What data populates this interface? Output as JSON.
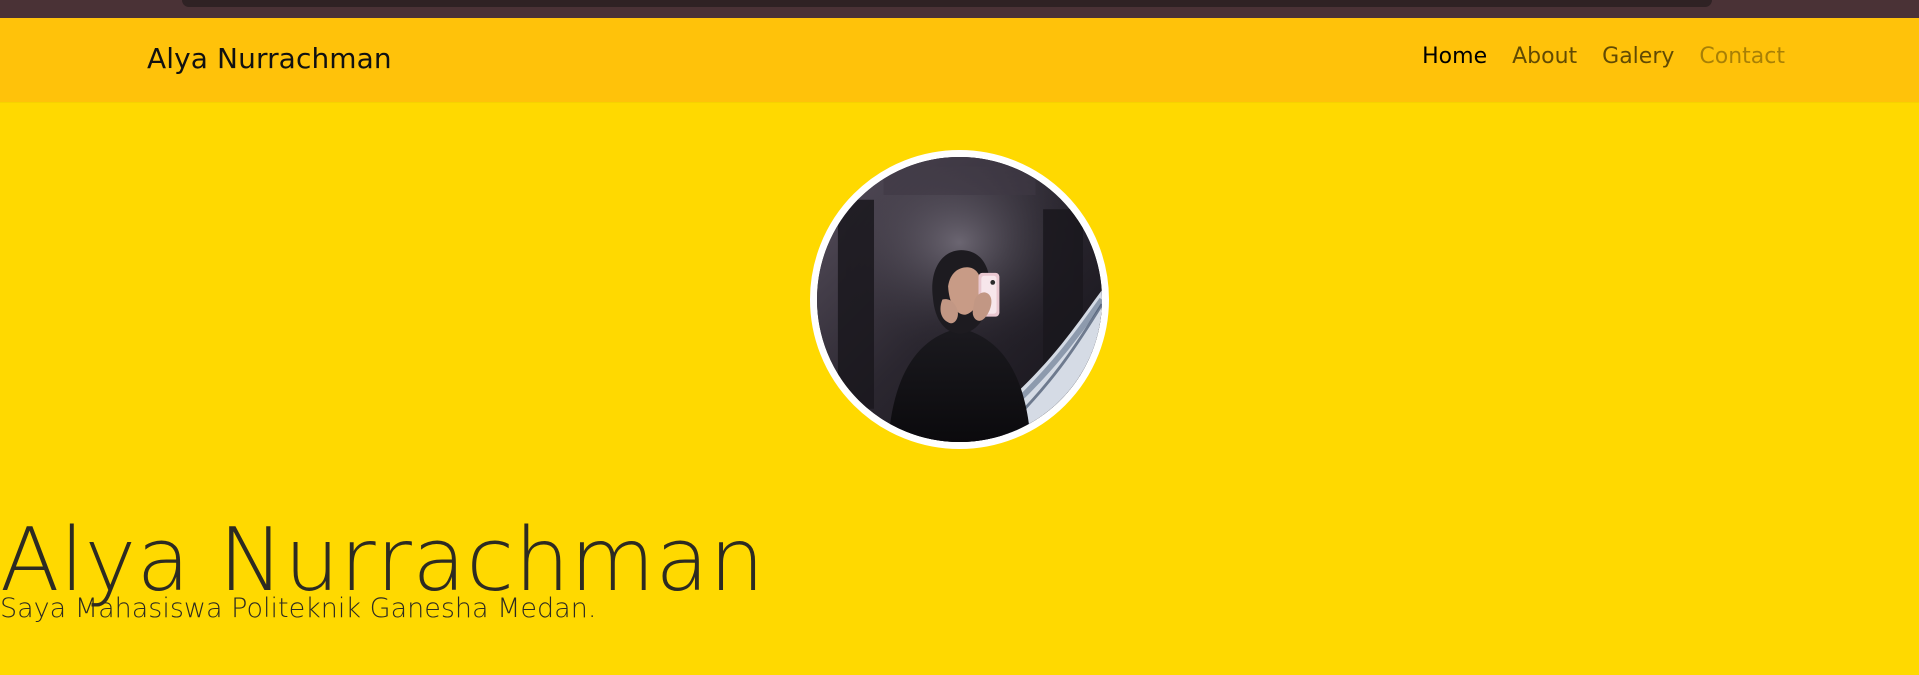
{
  "brand": {
    "name": "Alya Nurrachman"
  },
  "nav": [
    {
      "label": "Home",
      "state": "active"
    },
    {
      "label": "About",
      "state": "normal"
    },
    {
      "label": "Galery",
      "state": "normal"
    },
    {
      "label": "Contact",
      "state": "muted"
    }
  ],
  "hero": {
    "title": "Alya Nurrachman",
    "subtitle": "Saya Mahasiswa Politeknik Ganesha Medan."
  },
  "colors": {
    "page_background": "#ffd900",
    "navbar_background": "#ffc20a",
    "top_strip": "#4a3236",
    "avatar_border": "#ffffff"
  },
  "icons": {
    "avatar": "profile-photo-icon"
  }
}
